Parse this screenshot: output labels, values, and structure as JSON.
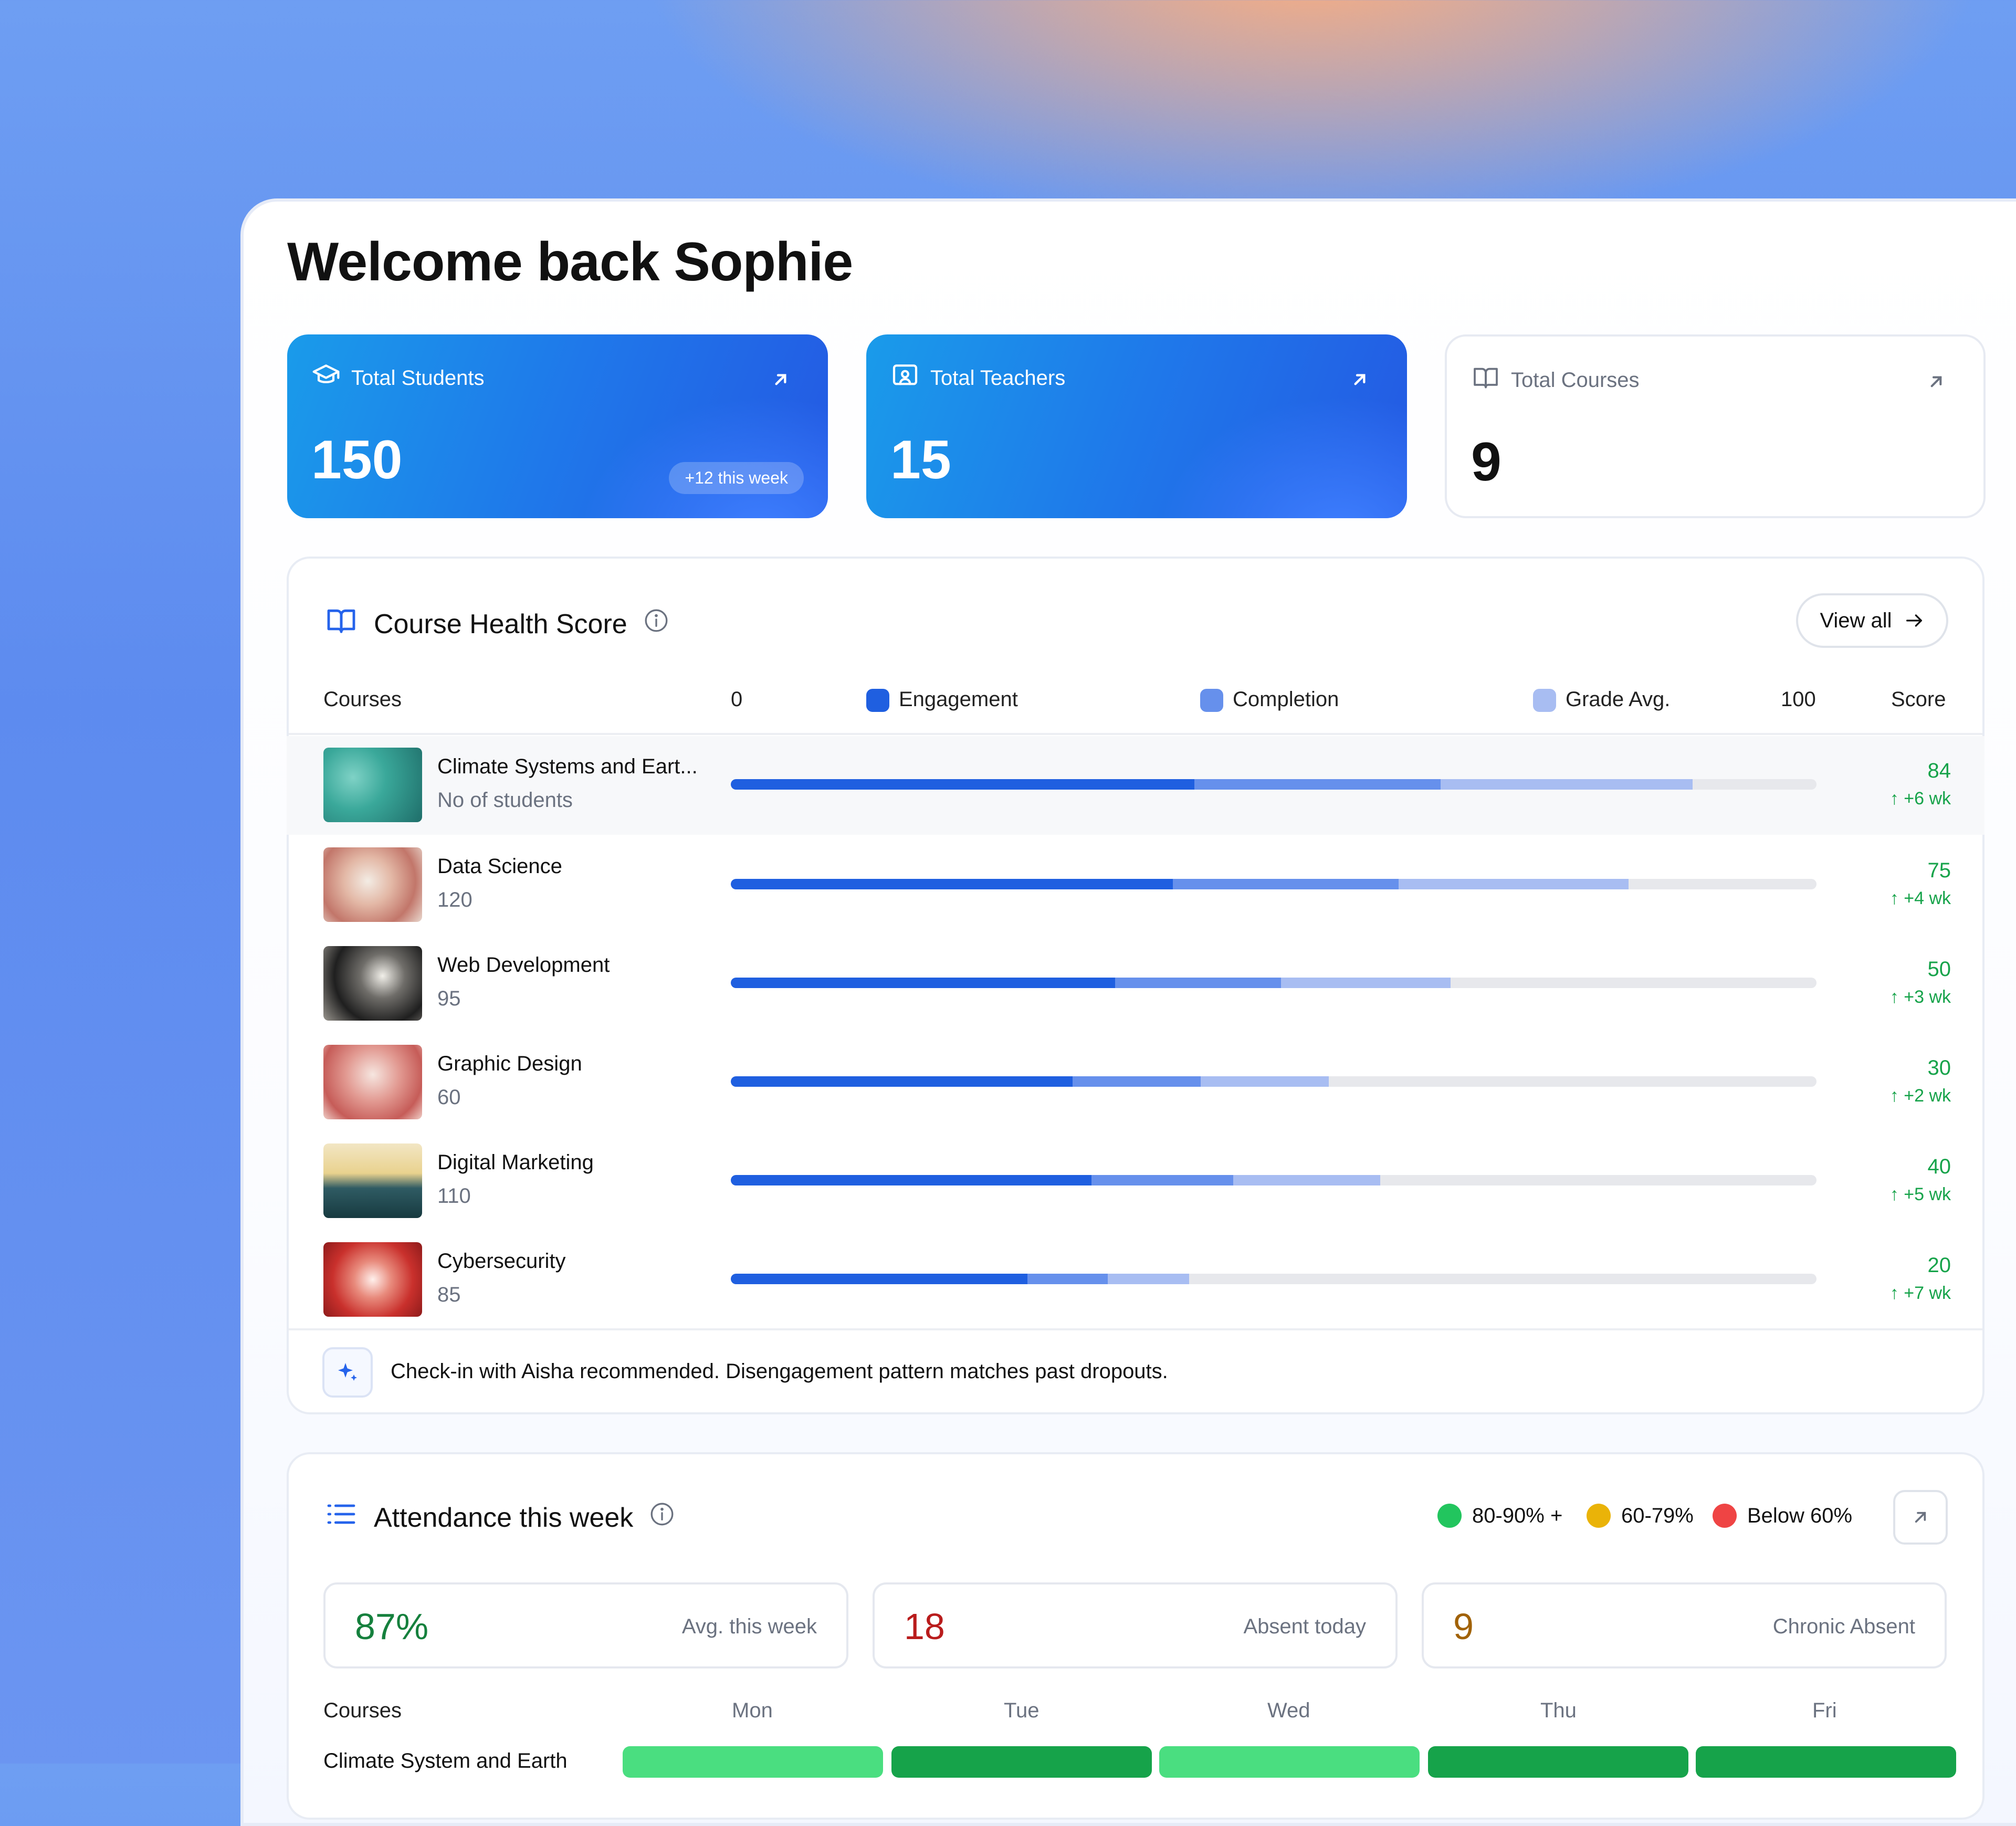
{
  "welcome": "Welcome back Sophie",
  "stats": [
    {
      "label": "Total Students",
      "value": "150",
      "badge": "+12 this week"
    },
    {
      "label": "Total Teachers",
      "value": "15"
    },
    {
      "label": "Total Courses",
      "value": "9"
    }
  ],
  "health": {
    "title": "Course Health Score",
    "view_all": "View all",
    "headers": {
      "courses": "Courses",
      "min": "0",
      "engagement": "Engagement",
      "completion": "Completion",
      "grade": "Grade Avg.",
      "max": "100",
      "score": "Score"
    },
    "colors": {
      "engagement": "#1f5fe0",
      "completion": "#6690ec",
      "grade": "#a8bdf2"
    },
    "courses": [
      {
        "name": "Climate Systems and Eart...",
        "sub": "No of students",
        "engagement": 42.7,
        "completion": 22.7,
        "grade": 23.2,
        "score": "84",
        "delta": "+6 wk"
      },
      {
        "name": "Data Science",
        "sub": "120",
        "engagement": 40.7,
        "completion": 20.8,
        "grade": 21.2,
        "score": "75",
        "delta": "+4 wk"
      },
      {
        "name": "Web Development",
        "sub": "95",
        "engagement": 35.4,
        "completion": 15.3,
        "grade": 15.6,
        "score": "50",
        "delta": "+3 wk"
      },
      {
        "name": "Graphic Design",
        "sub": "60",
        "engagement": 31.5,
        "completion": 11.8,
        "grade": 11.8,
        "score": "30",
        "delta": "+2 wk"
      },
      {
        "name": "Digital Marketing",
        "sub": "110",
        "engagement": 33.2,
        "completion": 13.1,
        "grade": 13.5,
        "score": "40",
        "delta": "+5 wk"
      },
      {
        "name": "Cybersecurity",
        "sub": "85",
        "engagement": 27.3,
        "completion": 7.4,
        "grade": 7.5,
        "score": "20",
        "delta": "+7 wk"
      }
    ],
    "insight": "Check-in with Aisha recommended. Disengagement pattern matches past dropouts."
  },
  "attendance": {
    "title": "Attendance this week",
    "legend": [
      {
        "label": "80-90% +",
        "color": "#22c55e"
      },
      {
        "label": "60-79%",
        "color": "#eab308"
      },
      {
        "label": "Below 60%",
        "color": "#ef4444"
      }
    ],
    "stats": [
      {
        "value": "87%",
        "label": "Avg. this week",
        "color": "#15803d"
      },
      {
        "value": "18",
        "label": "Absent today",
        "color": "#b91c1c"
      },
      {
        "value": "9",
        "label": "Chronic Absent",
        "color": "#a16207"
      }
    ],
    "table_header": "Courses",
    "days": [
      "Mon",
      "Tue",
      "Wed",
      "Thu",
      "Fri"
    ],
    "first_row": "Climate System and Earth",
    "first_row_colors": [
      "#4ade80",
      "#16a34a",
      "#4ade80",
      "#16a34a",
      "#16a34a"
    ]
  }
}
